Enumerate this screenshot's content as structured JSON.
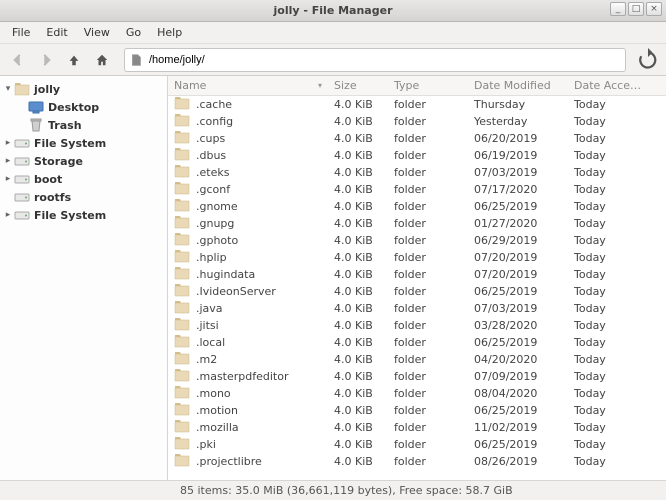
{
  "window": {
    "title": "jolly - File Manager",
    "controls": {
      "min": "_",
      "max": "□",
      "close": "×"
    }
  },
  "menubar": [
    "File",
    "Edit",
    "View",
    "Go",
    "Help"
  ],
  "toolbar": {
    "path": "/home/jolly/"
  },
  "sidebar": [
    {
      "label": "jolly",
      "icon": "folder",
      "expander": "▾",
      "bold": true
    },
    {
      "label": "Desktop",
      "icon": "desktop",
      "expander": "",
      "indent": 1,
      "bold": true
    },
    {
      "label": "Trash",
      "icon": "trash",
      "expander": "",
      "indent": 1,
      "bold": true
    },
    {
      "label": "File System",
      "icon": "drive",
      "expander": "▸",
      "bold": true
    },
    {
      "label": "Storage",
      "icon": "drive",
      "expander": "▸",
      "bold": true
    },
    {
      "label": "boot",
      "icon": "drive",
      "expander": "▸",
      "bold": true
    },
    {
      "label": "rootfs",
      "icon": "drive",
      "expander": "",
      "bold": true
    },
    {
      "label": "File System",
      "icon": "drive",
      "expander": "▸",
      "bold": true
    }
  ],
  "columns": {
    "name": "Name",
    "size": "Size",
    "type": "Type",
    "modified": "Date Modified",
    "accessed": "Date Accessed",
    "sort_indicator": "▾"
  },
  "files": [
    {
      "name": ".cache",
      "size": "4.0 KiB",
      "type": "folder",
      "modified": "Thursday",
      "accessed": "Today"
    },
    {
      "name": ".config",
      "size": "4.0 KiB",
      "type": "folder",
      "modified": "Yesterday",
      "accessed": "Today"
    },
    {
      "name": ".cups",
      "size": "4.0 KiB",
      "type": "folder",
      "modified": "06/20/2019",
      "accessed": "Today"
    },
    {
      "name": ".dbus",
      "size": "4.0 KiB",
      "type": "folder",
      "modified": "06/19/2019",
      "accessed": "Today"
    },
    {
      "name": ".eteks",
      "size": "4.0 KiB",
      "type": "folder",
      "modified": "07/03/2019",
      "accessed": "Today"
    },
    {
      "name": ".gconf",
      "size": "4.0 KiB",
      "type": "folder",
      "modified": "07/17/2020",
      "accessed": "Today"
    },
    {
      "name": ".gnome",
      "size": "4.0 KiB",
      "type": "folder",
      "modified": "06/25/2019",
      "accessed": "Today"
    },
    {
      "name": ".gnupg",
      "size": "4.0 KiB",
      "type": "folder",
      "modified": "01/27/2020",
      "accessed": "Today"
    },
    {
      "name": ".gphoto",
      "size": "4.0 KiB",
      "type": "folder",
      "modified": "06/29/2019",
      "accessed": "Today"
    },
    {
      "name": ".hplip",
      "size": "4.0 KiB",
      "type": "folder",
      "modified": "07/20/2019",
      "accessed": "Today"
    },
    {
      "name": ".hugindata",
      "size": "4.0 KiB",
      "type": "folder",
      "modified": "07/20/2019",
      "accessed": "Today"
    },
    {
      "name": ".IvideonServer",
      "size": "4.0 KiB",
      "type": "folder",
      "modified": "06/25/2019",
      "accessed": "Today"
    },
    {
      "name": ".java",
      "size": "4.0 KiB",
      "type": "folder",
      "modified": "07/03/2019",
      "accessed": "Today"
    },
    {
      "name": ".jitsi",
      "size": "4.0 KiB",
      "type": "folder",
      "modified": "03/28/2020",
      "accessed": "Today"
    },
    {
      "name": ".local",
      "size": "4.0 KiB",
      "type": "folder",
      "modified": "06/25/2019",
      "accessed": "Today"
    },
    {
      "name": ".m2",
      "size": "4.0 KiB",
      "type": "folder",
      "modified": "04/20/2020",
      "accessed": "Today"
    },
    {
      "name": ".masterpdfeditor",
      "size": "4.0 KiB",
      "type": "folder",
      "modified": "07/09/2019",
      "accessed": "Today"
    },
    {
      "name": ".mono",
      "size": "4.0 KiB",
      "type": "folder",
      "modified": "08/04/2020",
      "accessed": "Today"
    },
    {
      "name": ".motion",
      "size": "4.0 KiB",
      "type": "folder",
      "modified": "06/25/2019",
      "accessed": "Today"
    },
    {
      "name": ".mozilla",
      "size": "4.0 KiB",
      "type": "folder",
      "modified": "11/02/2019",
      "accessed": "Today"
    },
    {
      "name": ".pki",
      "size": "4.0 KiB",
      "type": "folder",
      "modified": "06/25/2019",
      "accessed": "Today"
    },
    {
      "name": ".projectlibre",
      "size": "4.0 KiB",
      "type": "folder",
      "modified": "08/26/2019",
      "accessed": "Today"
    }
  ],
  "statusbar": "85 items: 35.0 MiB (36,661,119 bytes), Free space: 58.7 GiB"
}
